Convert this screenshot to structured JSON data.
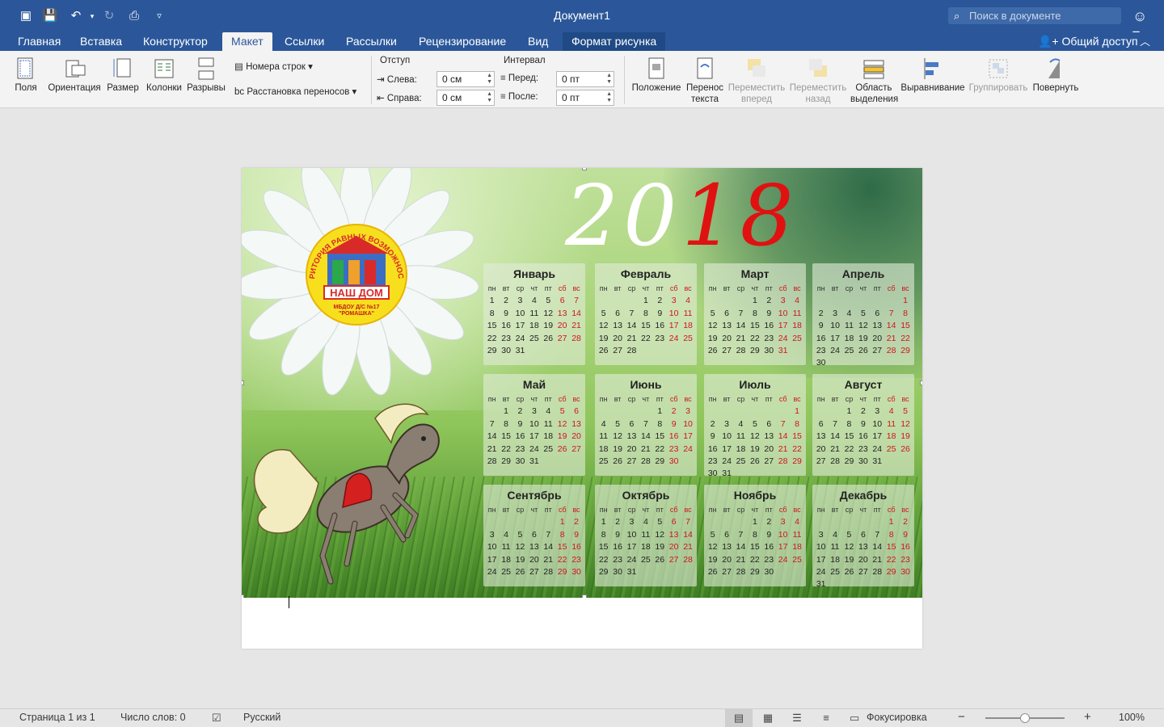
{
  "window": {
    "title": "Документ1",
    "search_placeholder": "Поиск в документе"
  },
  "tabs": [
    {
      "label": "Главная"
    },
    {
      "label": "Вставка"
    },
    {
      "label": "Конструктор"
    },
    {
      "label": "Макет"
    },
    {
      "label": "Ссылки"
    },
    {
      "label": "Рассылки"
    },
    {
      "label": "Рецензирование"
    },
    {
      "label": "Вид"
    },
    {
      "label": "Формат рисунка"
    }
  ],
  "share_label": "Общий доступ",
  "ribbon": {
    "margins": "Поля",
    "orientation": "Ориентация",
    "size": "Размер",
    "columns": "Колонки",
    "breaks": "Разрывы",
    "line_numbers": "Номера строк",
    "hyphenation": "Расстановка переносов",
    "indent_title": "Отступ",
    "indent_left_label": "Слева:",
    "indent_left_value": "0 см",
    "indent_right_label": "Справа:",
    "indent_right_value": "0 см",
    "spacing_title": "Интервал",
    "spacing_before_label": "Перед:",
    "spacing_before_value": "0 пт",
    "spacing_after_label": "После:",
    "spacing_after_value": "0 пт",
    "position": "Положение",
    "wrap_text_1": "Перенос",
    "wrap_text_2": "текста",
    "bring_forward_1": "Переместить",
    "bring_forward_2": "вперед",
    "send_backward_1": "Переместить",
    "send_backward_2": "назад",
    "selection_pane_1": "Область",
    "selection_pane_2": "выделения",
    "align": "Выравнивание",
    "group": "Группировать",
    "rotate": "Повернуть"
  },
  "calendar": {
    "year_white": "20",
    "year_red": "18",
    "logo_arc": "ТЕРРИТОРИЯ РАВНЫХ ВОЗМОЖНОСТЕЙ",
    "logo_name": "НАШ ДОМ",
    "logo_sub1": "МБДОУ Д/С №17",
    "logo_sub2": "\"РОМАШКА\"",
    "weekdays": [
      "пн",
      "вт",
      "ср",
      "чт",
      "пт",
      "сб",
      "вс"
    ],
    "months": [
      {
        "name": "Январь",
        "offset": 0,
        "days": 31
      },
      {
        "name": "Февраль",
        "offset": 3,
        "days": 28
      },
      {
        "name": "Март",
        "offset": 3,
        "days": 31
      },
      {
        "name": "Апрель",
        "offset": 6,
        "days": 30
      },
      {
        "name": "Май",
        "offset": 1,
        "days": 31
      },
      {
        "name": "Июнь",
        "offset": 4,
        "days": 30
      },
      {
        "name": "Июль",
        "offset": 6,
        "days": 31
      },
      {
        "name": "Август",
        "offset": 2,
        "days": 31
      },
      {
        "name": "Сентябрь",
        "offset": 5,
        "days": 30
      },
      {
        "name": "Октябрь",
        "offset": 0,
        "days": 31
      },
      {
        "name": "Ноябрь",
        "offset": 3,
        "days": 30
      },
      {
        "name": "Декабрь",
        "offset": 5,
        "days": 31
      }
    ]
  },
  "status": {
    "page": "Страница 1 из 1",
    "words": "Число слов: 0",
    "language": "Русский",
    "focus": "Фокусировка",
    "zoom": "100%",
    "zoom_level_percent": 100
  },
  "colors": {
    "brand": "#2b579a",
    "weekend": "#d0141e",
    "year_red": "#e01111"
  }
}
